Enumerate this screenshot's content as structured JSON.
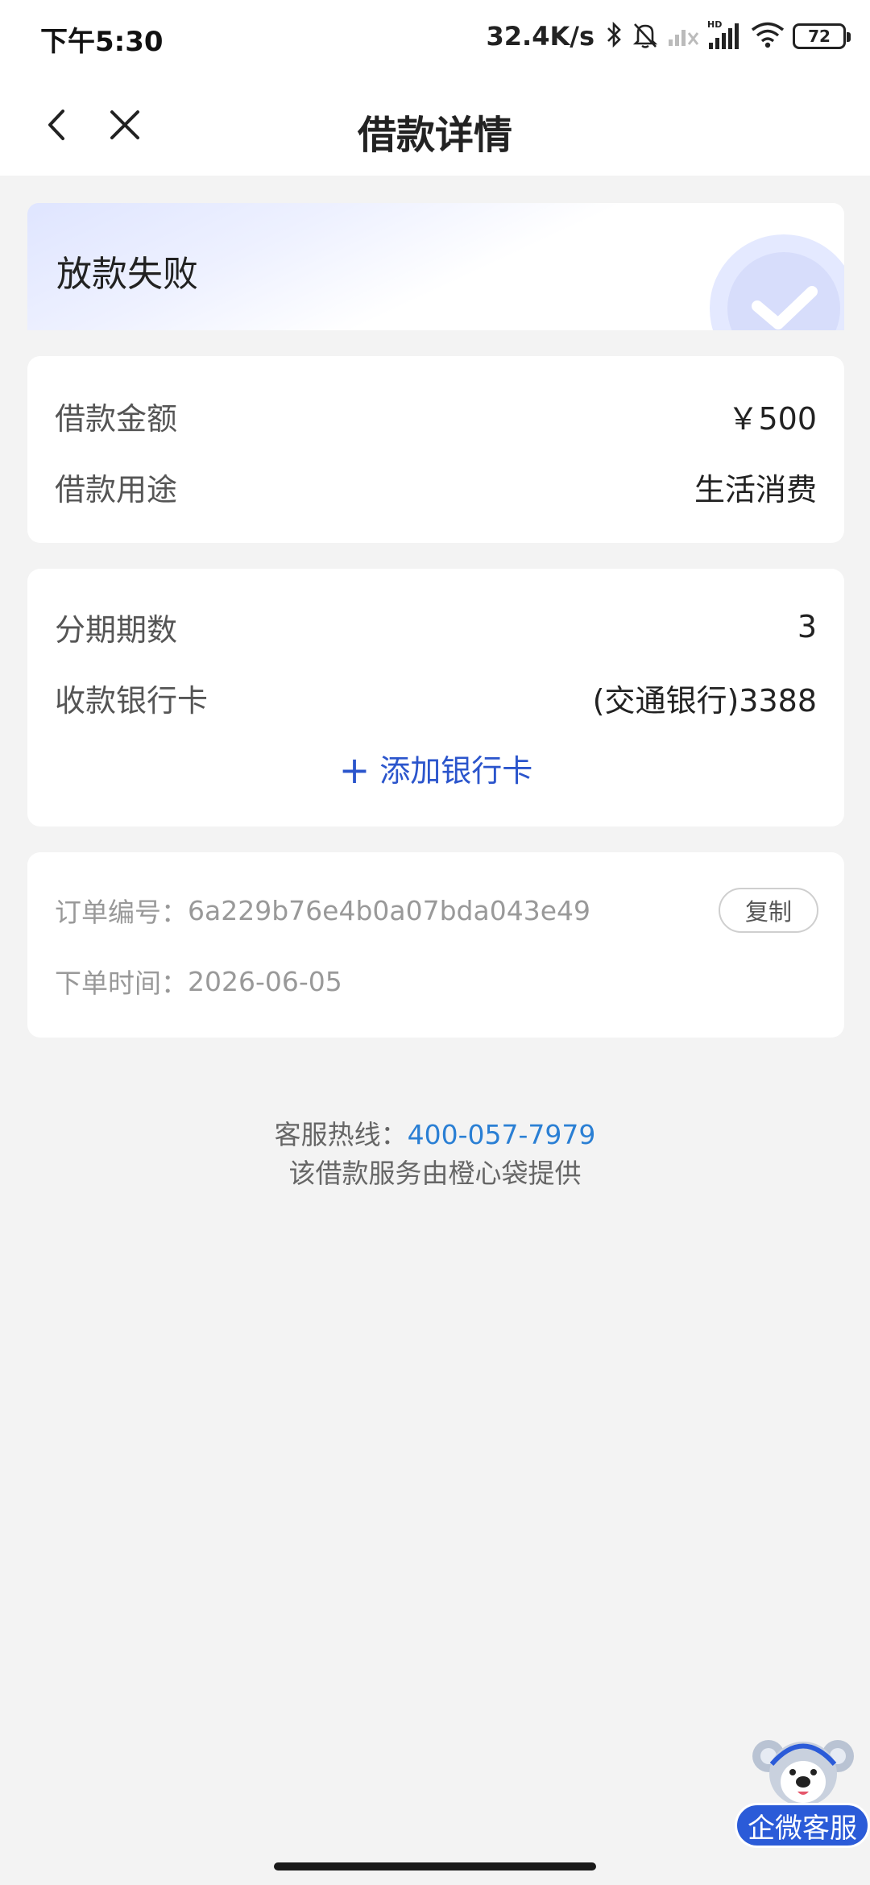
{
  "status_bar": {
    "time": "下午5:30",
    "net_speed": "32.4K/s",
    "battery": "72"
  },
  "nav": {
    "title": "借款详情"
  },
  "loan_status": "放款失败",
  "loan_info": {
    "amount_label": "借款金额",
    "amount_value": "￥500",
    "purpose_label": "借款用途",
    "purpose_value": "生活消费"
  },
  "installment": {
    "periods_label": "分期期数",
    "periods_value": "3",
    "card_label": "收款银行卡",
    "card_value": "(交通银行)3388",
    "add_card_plus": "+",
    "add_card_label": "添加银行卡"
  },
  "order": {
    "number_label": "订单编号：",
    "number_value": "6a229b76e4b0a07bda043e49",
    "copy_label": "复制",
    "time_label": "下单时间：",
    "time_value": "2026-06-05"
  },
  "footer": {
    "hotline_label": "客服热线：",
    "hotline_number": "400-057-7979",
    "provider_text": "该借款服务由橙心袋提供"
  },
  "floating_service": {
    "label": "企微客服"
  },
  "colors": {
    "accent_blue": "#2b55cc",
    "link_blue": "#2a7fd4",
    "float_button_blue": "#2b5bd8",
    "page_bg": "#f3f3f3"
  },
  "icons": {
    "back": "chevron-left-icon",
    "close": "close-icon",
    "bluetooth": "bluetooth-icon",
    "silent": "bell-off-icon",
    "wifi": "wifi-icon"
  }
}
